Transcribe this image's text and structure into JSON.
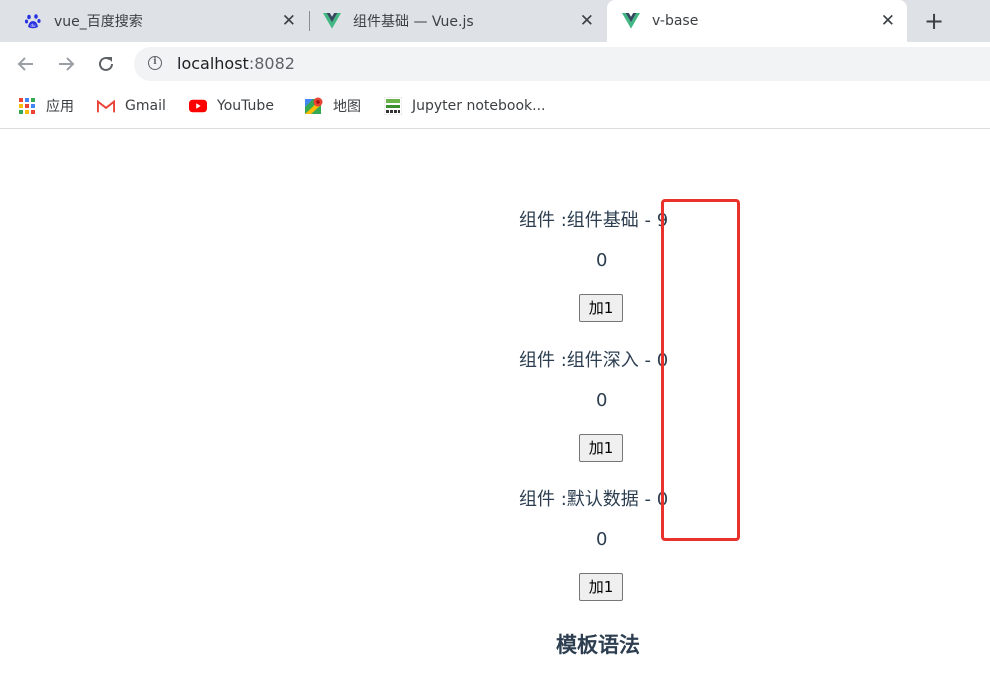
{
  "browser": {
    "tabs": [
      {
        "title": "vue_百度搜索",
        "icon": "baidu-paw-icon",
        "active": false
      },
      {
        "title": "组件基础 — Vue.js",
        "icon": "vue-logo-icon",
        "active": false
      },
      {
        "title": "v-base",
        "icon": "vue-logo-icon",
        "active": true
      }
    ],
    "close_glyph": "✕",
    "new_tab_glyph": "+",
    "address": {
      "host": "localhost",
      "port": ":8082"
    },
    "bookmarks": [
      {
        "label": "应用",
        "icon": "apps-grid-icon"
      },
      {
        "label": "Gmail",
        "icon": "gmail-icon"
      },
      {
        "label": "YouTube",
        "icon": "youtube-icon"
      },
      {
        "label": "地图",
        "icon": "maps-icon"
      },
      {
        "label": "Jupyter notebook...",
        "icon": "jupyter-icon"
      }
    ]
  },
  "page": {
    "components": [
      {
        "label": "组件 :组件基础 - 9",
        "count": "0",
        "button": "加1"
      },
      {
        "label": "组件 :组件深入 - 0",
        "count": "0",
        "button": "加1"
      },
      {
        "label": "组件 :默认数据 - 0",
        "count": "0",
        "button": "加1"
      }
    ],
    "section_heading": "模板语法"
  },
  "colors": {
    "annotation": "#e8322b",
    "vue_green": "#41b883",
    "vue_dark": "#35495e"
  }
}
